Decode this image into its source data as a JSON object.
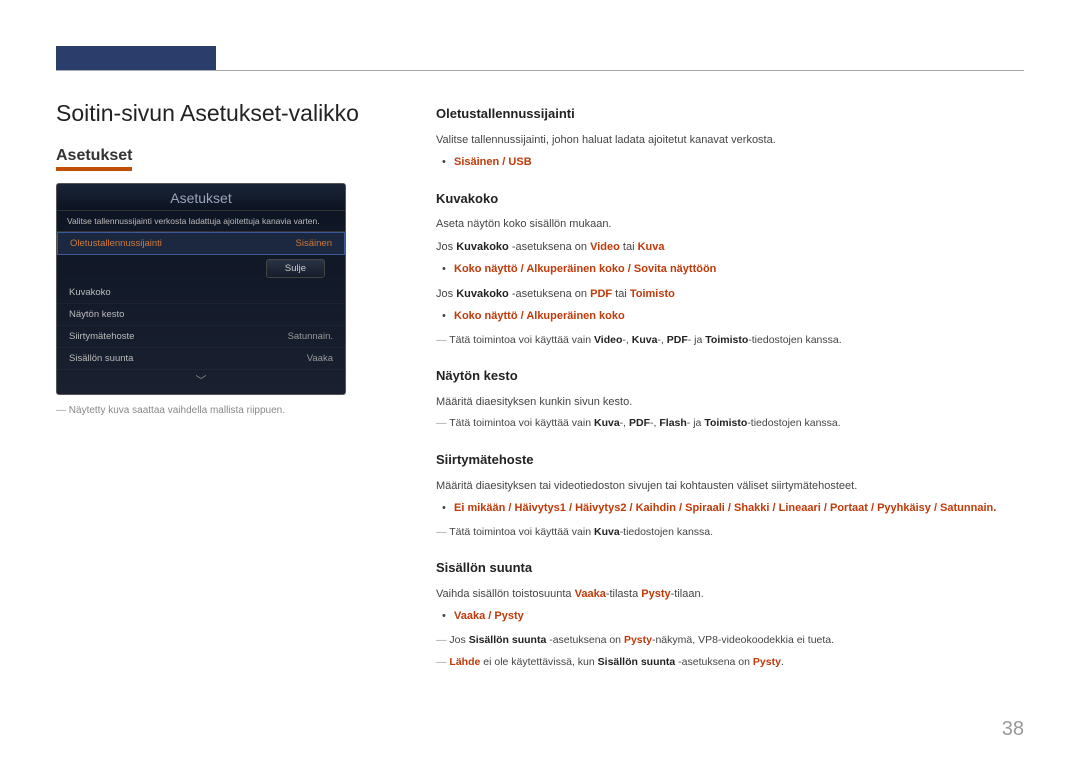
{
  "page_title": "Soitin-sivun Asetukset-valikko",
  "section_heading": "Asetukset",
  "settings_panel": {
    "title": "Asetukset",
    "description": "Valitse tallennussijainti verkosta ladattuja ajoitettuja kanavia varten.",
    "rows": [
      {
        "label": "Oletustallennussijainti",
        "value": "Sisäinen",
        "selected": true
      },
      {
        "label": "Kuvakoko",
        "value": ""
      },
      {
        "label": "Näytön kesto",
        "value": ""
      },
      {
        "label": "Siirtymätehoste",
        "value": "Satunnain."
      },
      {
        "label": "Sisällön suunta",
        "value": "Vaaka"
      }
    ],
    "close_label": "Sulje"
  },
  "panel_caption": "Näytetty kuva saattaa vaihdella mallista riippuen.",
  "sections": {
    "oletustallennussijainti": {
      "heading": "Oletustallennussijainti",
      "desc": "Valitse tallennussijainti, johon haluat ladata ajoitetut kanavat verkosta.",
      "options": "Sisäinen / USB"
    },
    "kuvakoko": {
      "heading": "Kuvakoko",
      "desc": "Aseta näytön koko sisällön mukaan.",
      "line1_pre": "Jos ",
      "line1_bold1": "Kuvakoko",
      "line1_mid": " -asetuksena on ",
      "line1_hl1": "Video",
      "line1_or": " tai ",
      "line1_hl2": "Kuva",
      "options1": "Koko näyttö / Alkuperäinen koko / Sovita näyttöön",
      "line2_pre": "Jos ",
      "line2_bold1": "Kuvakoko",
      "line2_mid": " -asetuksena on ",
      "line2_hl1": "PDF",
      "line2_or": " tai ",
      "line2_hl2": "Toimisto",
      "options2": "Koko näyttö / Alkuperäinen koko",
      "note_pre": "Tätä toimintoa voi käyttää vain ",
      "note_h1": "Video",
      "note_h2": "Kuva",
      "note_h3": "PDF",
      "note_h4": "Toimisto",
      "note_suf": "-tiedostojen kanssa."
    },
    "naytonkesto": {
      "heading": "Näytön kesto",
      "desc": "Määritä diaesityksen kunkin sivun kesto.",
      "note_pre": "Tätä toimintoa voi käyttää vain ",
      "note_h1": "Kuva",
      "note_h2": "PDF",
      "note_h3": "Flash",
      "note_h4": "Toimisto",
      "note_suf": "-tiedostojen kanssa."
    },
    "siirtymatehoste": {
      "heading": "Siirtymätehoste",
      "desc": "Määritä diaesityksen tai videotiedoston sivujen tai kohtausten väliset siirtymätehosteet.",
      "options": "Ei mikään / Häivytys1 / Häivytys2 / Kaihdin / Spiraali / Shakki / Lineaari / Portaat / Pyyhkäisy / Satunnain.",
      "note_pre": "Tätä toimintoa voi käyttää vain ",
      "note_h1": "Kuva",
      "note_suf": "-tiedostojen kanssa."
    },
    "sisallonsuunta": {
      "heading": "Sisällön suunta",
      "desc_pre": "Vaihda sisällön toistosuunta ",
      "desc_h1": "Vaaka",
      "desc_mid": "-tilasta ",
      "desc_h2": "Pysty",
      "desc_suf": "-tilaan.",
      "options": "Vaaka / Pysty",
      "note1_pre": "Jos ",
      "note1_b1": "Sisällön suunta",
      "note1_mid": " -asetuksena on ",
      "note1_h1": "Pysty",
      "note1_suf": "-näkymä, VP8-videokoodekkia ei tueta.",
      "note2_h1": "Lähde",
      "note2_mid": " ei ole käytettävissä, kun ",
      "note2_b1": "Sisällön suunta",
      "note2_mid2": " -asetuksena on ",
      "note2_h2": "Pysty",
      "note2_suf": "."
    }
  },
  "page_number": "38"
}
